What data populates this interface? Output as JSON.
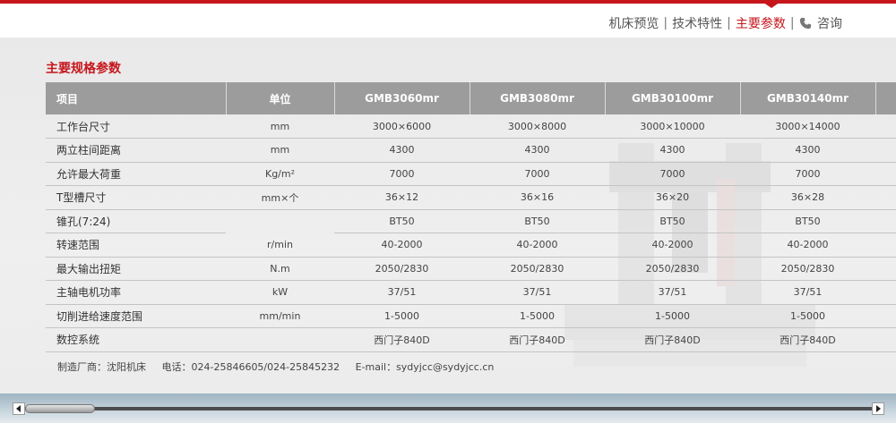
{
  "nav": {
    "items": [
      {
        "label": "机床预览",
        "active": false
      },
      {
        "label": "技术特性",
        "active": false
      },
      {
        "label": "主要参数",
        "active": true
      }
    ],
    "consult_label": "咨询",
    "separator": "|"
  },
  "colors": {
    "accent": "#c6161c",
    "header_bg": "#9c9c9c",
    "row_line": "#c4c4c4"
  },
  "section_title": "主要规格参数",
  "table": {
    "columns": [
      "项目",
      "单位",
      "GMB3060mr",
      "GMB3080mr",
      "GMB30100mr",
      "GMB30140mr",
      ""
    ],
    "rows": [
      [
        "工作台尺寸",
        "mm",
        "3000×6000",
        "3000×8000",
        "3000×10000",
        "3000×14000",
        ""
      ],
      [
        "两立柱间距离",
        "mm",
        "4300",
        "4300",
        "4300",
        "4300",
        ""
      ],
      [
        "允许最大荷重",
        "Kg/m²",
        "7000",
        "7000",
        "7000",
        "7000",
        ""
      ],
      [
        "T型槽尺寸",
        "mm×个",
        "36×12",
        "36×16",
        "36×20",
        "36×28",
        ""
      ],
      [
        "锥孔(7:24)",
        "",
        "BT50",
        "BT50",
        "BT50",
        "BT50",
        ""
      ],
      [
        "转速范围",
        "r/min",
        "40-2000",
        "40-2000",
        "40-2000",
        "40-2000",
        ""
      ],
      [
        "最大输出扭矩",
        "N.m",
        "2050/2830",
        "2050/2830",
        "2050/2830",
        "2050/2830",
        ""
      ],
      [
        "主轴电机功率",
        "kW",
        "37/51",
        "37/51",
        "37/51",
        "37/51",
        ""
      ],
      [
        "切削进给速度范围",
        "mm/min",
        "1-5000",
        "1-5000",
        "1-5000",
        "1-5000",
        ""
      ],
      [
        "数控系统",
        "",
        "西门子840D",
        "西门子840D",
        "西门子840D",
        "西门子840D",
        ""
      ]
    ]
  },
  "footer": {
    "text": "制造厂商：沈阳机床     电话：024-25846605/024-25845232     E-mail：sydyjcc@sydyjcc.cn"
  },
  "scrollbar": {
    "position": 0
  }
}
